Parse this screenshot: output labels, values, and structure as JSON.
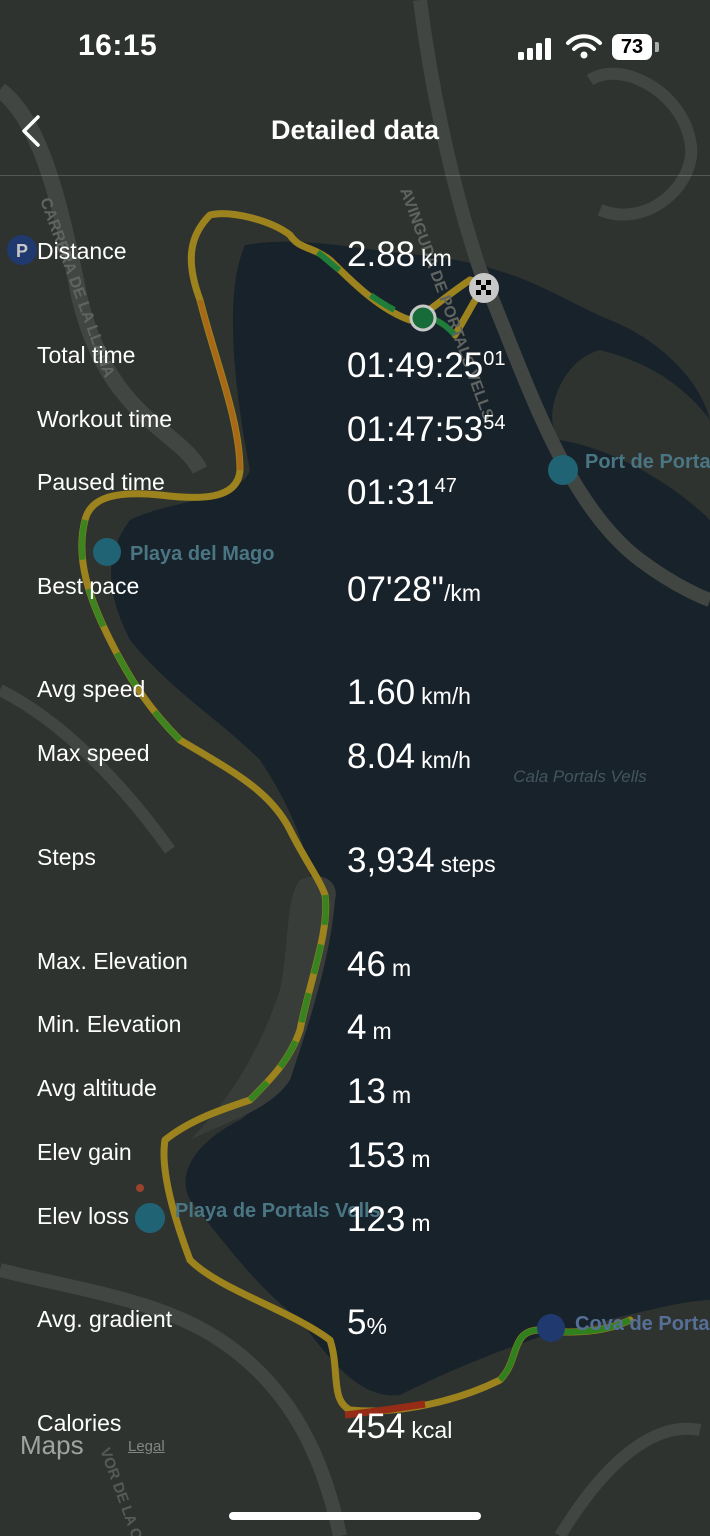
{
  "status_bar": {
    "time": "16:15",
    "battery": "73"
  },
  "header": {
    "title": "Detailed data"
  },
  "stats": [
    {
      "label": "Distance",
      "value": "2.88",
      "unit": "km"
    },
    {
      "label": "Total time",
      "value": "01:49:25",
      "sup": "01"
    },
    {
      "label": "Workout time",
      "value": "01:47:53",
      "sup": "54"
    },
    {
      "label": "Paused time",
      "value": "01:31",
      "sup": "47"
    },
    {
      "label": "Best pace",
      "value": "07'28\"",
      "unit": "/km"
    },
    {
      "label": "Avg speed",
      "value": "1.60",
      "unit": "km/h"
    },
    {
      "label": "Max speed",
      "value": "8.04",
      "unit": "km/h"
    },
    {
      "label": "Steps",
      "value": "3,934",
      "unit": "steps"
    },
    {
      "label": "Max. Elevation",
      "value": "46",
      "unit": "m"
    },
    {
      "label": "Min. Elevation",
      "value": "4",
      "unit": "m"
    },
    {
      "label": "Avg altitude",
      "value": "13",
      "unit": "m"
    },
    {
      "label": "Elev gain",
      "value": "153",
      "unit": "m"
    },
    {
      "label": "Elev loss",
      "value": "123",
      "unit": "m"
    },
    {
      "label": "Avg. gradient",
      "value": "5",
      "unit": "%"
    },
    {
      "label": "Calories",
      "value": "454",
      "unit": "kcal"
    }
  ],
  "map": {
    "street_labels": [
      "CARRERA DE LA LLANA",
      "AVINGUDA DE PORTALS VELLS",
      "VOR DE LA CO"
    ],
    "place_labels": [
      "Playa del Mago",
      "Port de Portals Vells",
      "Cala Portals Vells",
      "Playa de Portals Vells",
      "Cova de Portals Vells"
    ],
    "attribution": "Maps",
    "legal": "Legal",
    "icons": [
      "parking-icon",
      "beach-umbrella-icon",
      "marina-icon",
      "star-icon",
      "finish-flag-icon"
    ]
  },
  "colors": {
    "land": "#3c423d",
    "water": "#1f2c36",
    "accent_green": "#2aa04a",
    "track_yellow": "#c9a826",
    "track_orange": "#d8861f",
    "track_red": "#c0391d"
  }
}
